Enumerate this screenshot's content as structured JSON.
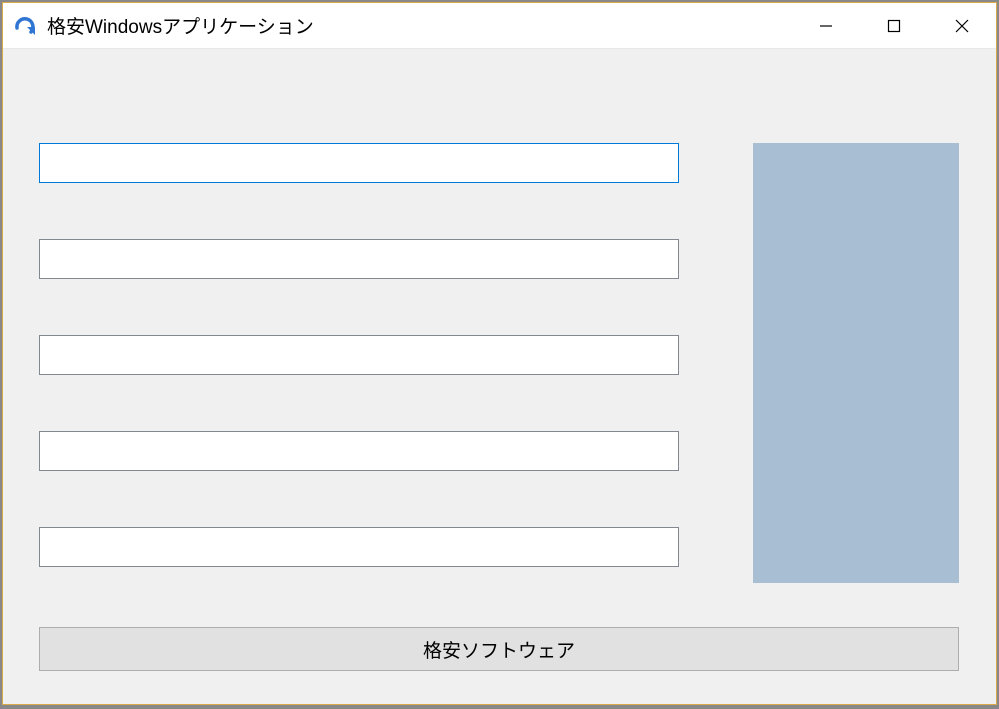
{
  "window": {
    "title": "格安Windowsアプリケーション"
  },
  "inputs": {
    "field1": "",
    "field2": "",
    "field3": "",
    "field4": "",
    "field5": ""
  },
  "button": {
    "label": "格安ソフトウェア"
  }
}
